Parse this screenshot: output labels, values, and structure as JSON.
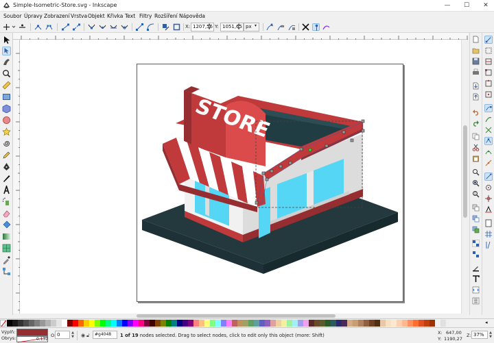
{
  "window": {
    "title": "Simple-Isometric-Store.svg - Inkscape",
    "minimize_glyph": "—",
    "maximize_glyph": "☐",
    "close_glyph": "✕"
  },
  "menu": [
    "Soubor",
    "Úpravy",
    "Zobrazení",
    "Vrstva",
    "Objekt",
    "Křivka",
    "Text",
    "Filtry",
    "Rozšíření",
    "Nápověda"
  ],
  "controls": {
    "x_label": "X:",
    "x_value": "1207,56",
    "y_label": "Y:",
    "y_value": "1051,65",
    "unit": "px"
  },
  "artwork": {
    "sign_text": "STORE",
    "colors": {
      "red": "#c0393b",
      "red_dark": "#962d30",
      "red_light": "#dc4b4c",
      "roof": "#1f3d43",
      "wall_light": "#f1f1f1",
      "wall_side": "#d9d9d9",
      "glass": "#56d6f5",
      "base_top": "#23393e",
      "base_side": "#172a2e",
      "awning_white": "#ffffff"
    }
  },
  "palette": [
    "#000000",
    "#1a1a1a",
    "#333333",
    "#4d4d4d",
    "#666666",
    "#808080",
    "#999999",
    "#b3b3b3",
    "#cccccc",
    "#e6e6e6",
    "#ffffff",
    "#800000",
    "#ff0000",
    "#ff6600",
    "#ffcc00",
    "#ffff00",
    "#80ff00",
    "#00ff00",
    "#00ff80",
    "#00ffff",
    "#0080ff",
    "#0000ff",
    "#8000ff",
    "#ff00ff",
    "#ff0080",
    "#800040",
    "#400000",
    "#804000",
    "#808000",
    "#008000",
    "#008080",
    "#000080",
    "#400080",
    "#800080",
    "#ff8080",
    "#ffbf80",
    "#ffff80",
    "#80ff80",
    "#80ffff",
    "#8080ff",
    "#ff80ff",
    "#c06060",
    "#c09060",
    "#a0a060",
    "#60a060",
    "#60a0a0",
    "#6060c0",
    "#9060c0",
    "#e0a0a0",
    "#f0d0a0",
    "#f0f0a0",
    "#a0f0a0",
    "#a0f0f0",
    "#a0a0f0",
    "#f0a0f0",
    "#5a2a2a",
    "#6a4a2a",
    "#5a5a2a",
    "#2a5a2a",
    "#2a5a5a",
    "#2a2a6a",
    "#4a2a5a",
    "#d4aa88",
    "#c8a070",
    "#b08060",
    "#906040",
    "#704020",
    "#503010",
    "#e8c8a8",
    "#f8e0c0",
    "#ffe8d0",
    "#ffd0b0",
    "#ffb890",
    "#ff9060",
    "#ff7030",
    "#e05020",
    "#c04010",
    "#a03000",
    "#f0f0f0",
    "#e0e0e0"
  ],
  "status": {
    "fill_label": "Výplň:",
    "stroke_label": "Obrys:",
    "fill_color": "#962d30",
    "stroke_width": "0,132",
    "opacity_label": "O:",
    "opacity_value": "0",
    "object_id": "#g4048",
    "message_bold": "1 of 19",
    "message_rest": "nodes selected. Drag to select nodes, click to edit only this object (more: Shift)",
    "x_label": "X:",
    "x_value": "647,00",
    "y_label": "Y:",
    "y_value": "1190,27",
    "zoom_label": "Z:",
    "zoom_value": "37%"
  }
}
